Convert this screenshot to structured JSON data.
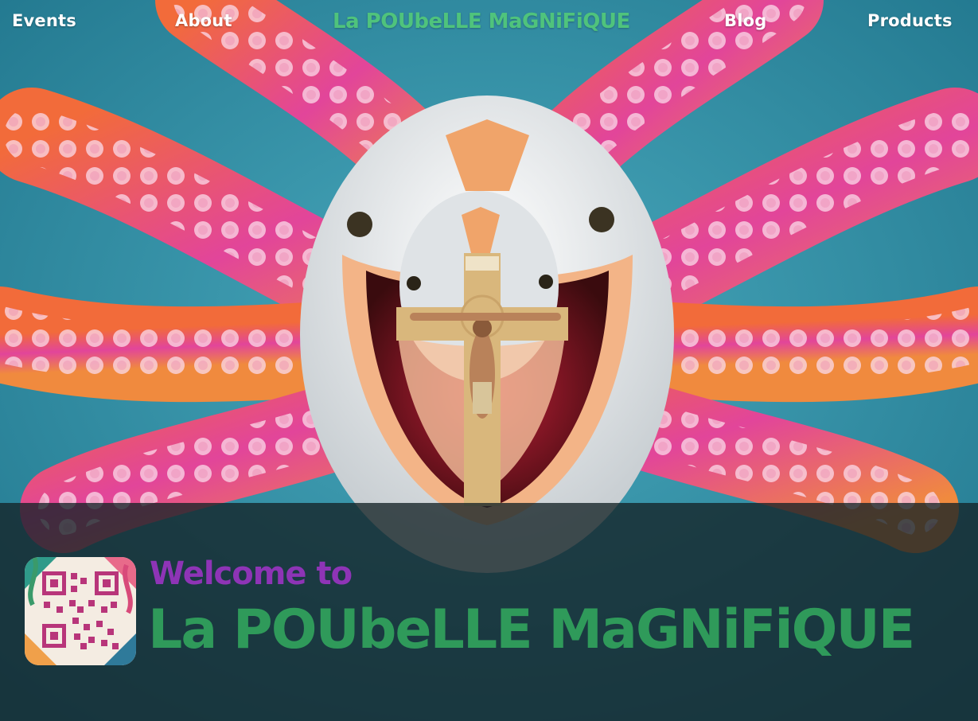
{
  "nav": {
    "events": "Events",
    "about": "About",
    "brand": "La POUbeLLE MaGNiFiQUE",
    "blog": "Blog",
    "products": "Products"
  },
  "hero": {
    "welcome": "Welcome to",
    "title": "La POUbeLLE MaGNiFiQUE"
  },
  "colors": {
    "brand_green": "#4fc37c",
    "title_green": "#2f9a5a",
    "welcome_purple": "#8e34b6",
    "background_teal": "#2b8fa6"
  }
}
